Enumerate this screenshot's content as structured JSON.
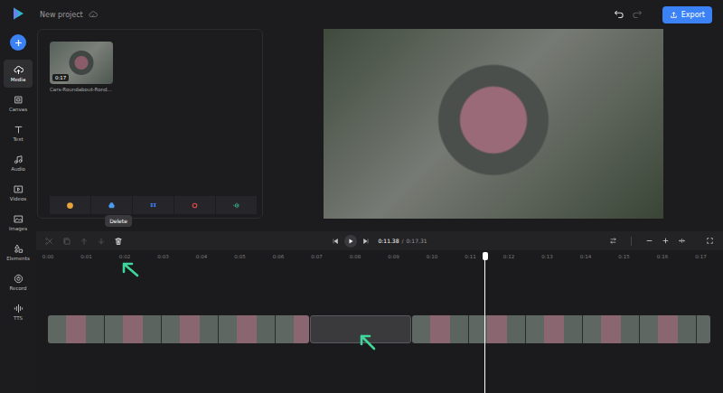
{
  "project": {
    "title": "New project"
  },
  "header": {
    "export_label": "Export",
    "undo_enabled": true,
    "redo_enabled": false
  },
  "sidebar": {
    "items": [
      {
        "label": "Media",
        "selected": true
      },
      {
        "label": "Canvas",
        "selected": false
      },
      {
        "label": "Text",
        "selected": false
      },
      {
        "label": "Audio",
        "selected": false
      },
      {
        "label": "Videos",
        "selected": false
      },
      {
        "label": "Images",
        "selected": false
      },
      {
        "label": "Elements",
        "selected": false
      },
      {
        "label": "Record",
        "selected": false
      },
      {
        "label": "TTS",
        "selected": false
      }
    ]
  },
  "media": {
    "items": [
      {
        "name": "Cars-Roundabout-Rond...",
        "duration": "0:17",
        "selected": false
      }
    ]
  },
  "toolbar": {
    "tools": [
      {
        "disabled": true,
        "tooltip": ""
      },
      {
        "disabled": true,
        "tooltip": ""
      },
      {
        "disabled": true,
        "tooltip": ""
      },
      {
        "disabled": true,
        "tooltip": ""
      },
      {
        "disabled": false,
        "tooltip": "Delete"
      }
    ]
  },
  "playback": {
    "current": "0:11.38",
    "separator": "/",
    "total": "0:17.31",
    "playing": false
  },
  "ruler": {
    "ticks": [
      "0:00",
      "0:01",
      "0:02",
      "0:03",
      "0:04",
      "0:05",
      "0:06",
      "0:07",
      "0:08",
      "0:09",
      "0:10",
      "0:11",
      "0:12",
      "0:13",
      "0:14",
      "0:15",
      "0:16",
      "0:17"
    ]
  },
  "track": {
    "items": [
      {
        "kind": "clip",
        "level": 0.393,
        "selected": false
      },
      {
        "kind": "gap",
        "level": 0.152,
        "selected": true
      },
      {
        "kind": "clip",
        "level": 0.45,
        "selected": false
      }
    ]
  },
  "playhead": {
    "level": 0.658
  }
}
